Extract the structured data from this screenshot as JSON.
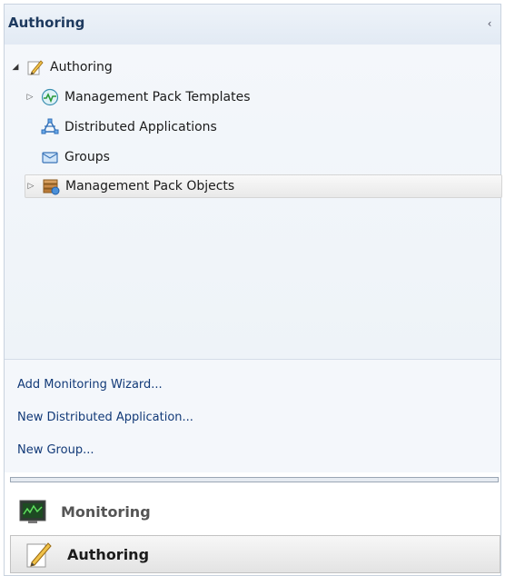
{
  "header": {
    "title": "Authoring",
    "collapse_glyph": "‹"
  },
  "tree": {
    "root": {
      "label": "Authoring",
      "icon": "pencil-document-icon",
      "expanded": true
    },
    "items": [
      {
        "label": "Management Pack Templates",
        "icon": "template-wave-icon",
        "expandable": true
      },
      {
        "label": "Distributed Applications",
        "icon": "distributed-app-icon",
        "expandable": false
      },
      {
        "label": "Groups",
        "icon": "groups-icon",
        "expandable": false
      },
      {
        "label": "Management Pack Objects",
        "icon": "management-pack-objects-icon",
        "expandable": true,
        "selected": true
      }
    ]
  },
  "tasks": [
    {
      "label": "Add Monitoring Wizard..."
    },
    {
      "label": "New Distributed Application..."
    },
    {
      "label": "New Group..."
    }
  ],
  "wunderbar": [
    {
      "label": "Monitoring",
      "icon": "monitor-screen-icon",
      "active": false
    },
    {
      "label": "Authoring",
      "icon": "pencil-document-icon",
      "active": true
    }
  ],
  "colors": {
    "accent": "#1e3a5f",
    "link": "#123a78",
    "pane_bg": "#f4f7fb"
  }
}
